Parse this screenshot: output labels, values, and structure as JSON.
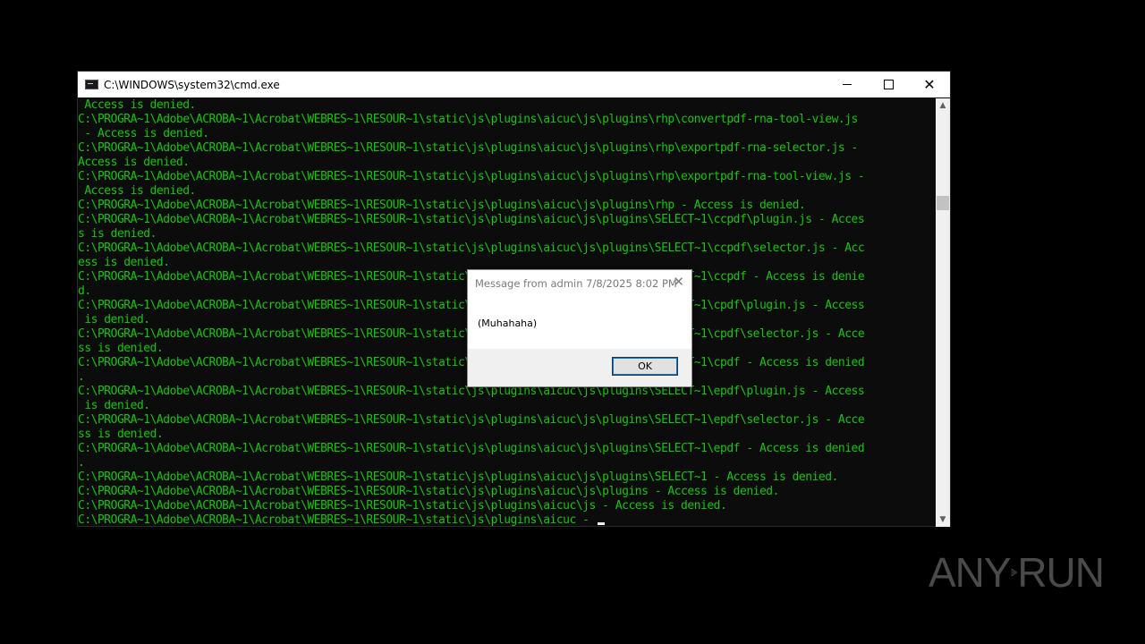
{
  "window": {
    "title": "C:\\WINDOWS\\system32\\cmd.exe",
    "controls": {
      "minimize": "minimize",
      "maximize": "maximize",
      "close": "✕"
    }
  },
  "console": {
    "lines": [
      " Access is denied.",
      "C:\\PROGRA~1\\Adobe\\ACROBA~1\\Acrobat\\WEBRES~1\\RESOUR~1\\static\\js\\plugins\\aicuc\\js\\plugins\\rhp\\convertpdf-rna-tool-view.js",
      " - Access is denied.",
      "C:\\PROGRA~1\\Adobe\\ACROBA~1\\Acrobat\\WEBRES~1\\RESOUR~1\\static\\js\\plugins\\aicuc\\js\\plugins\\rhp\\exportpdf-rna-selector.js -",
      "Access is denied.",
      "C:\\PROGRA~1\\Adobe\\ACROBA~1\\Acrobat\\WEBRES~1\\RESOUR~1\\static\\js\\plugins\\aicuc\\js\\plugins\\rhp\\exportpdf-rna-tool-view.js -",
      " Access is denied.",
      "C:\\PROGRA~1\\Adobe\\ACROBA~1\\Acrobat\\WEBRES~1\\RESOUR~1\\static\\js\\plugins\\aicuc\\js\\plugins\\rhp - Access is denied.",
      "C:\\PROGRA~1\\Adobe\\ACROBA~1\\Acrobat\\WEBRES~1\\RESOUR~1\\static\\js\\plugins\\aicuc\\js\\plugins\\SELECT~1\\ccpdf\\plugin.js - Acces",
      "s is denied.",
      "C:\\PROGRA~1\\Adobe\\ACROBA~1\\Acrobat\\WEBRES~1\\RESOUR~1\\static\\js\\plugins\\aicuc\\js\\plugins\\SELECT~1\\ccpdf\\selector.js - Acc",
      "ess is denied.",
      "C:\\PROGRA~1\\Adobe\\ACROBA~1\\Acrobat\\WEBRES~1\\RESOUR~1\\static\\js\\plugins\\aicuc\\js\\plugins\\SELECT~1\\ccpdf - Access is denie",
      "d.",
      "C:\\PROGRA~1\\Adobe\\ACROBA~1\\Acrobat\\WEBRES~1\\RESOUR~1\\static\\js\\plugins\\aicuc\\js\\plugins\\SELECT~1\\cpdf\\plugin.js - Access",
      " is denied.",
      "C:\\PROGRA~1\\Adobe\\ACROBA~1\\Acrobat\\WEBRES~1\\RESOUR~1\\static\\js\\plugins\\aicuc\\js\\plugins\\SELECT~1\\cpdf\\selector.js - Acce",
      "ss is denied.",
      "C:\\PROGRA~1\\Adobe\\ACROBA~1\\Acrobat\\WEBRES~1\\RESOUR~1\\static\\js\\plugins\\aicuc\\js\\plugins\\SELECT~1\\cpdf - Access is denied",
      ".",
      "C:\\PROGRA~1\\Adobe\\ACROBA~1\\Acrobat\\WEBRES~1\\RESOUR~1\\static\\js\\plugins\\aicuc\\js\\plugins\\SELECT~1\\epdf\\plugin.js - Access",
      " is denied.",
      "C:\\PROGRA~1\\Adobe\\ACROBA~1\\Acrobat\\WEBRES~1\\RESOUR~1\\static\\js\\plugins\\aicuc\\js\\plugins\\SELECT~1\\epdf\\selector.js - Acce",
      "ss is denied.",
      "C:\\PROGRA~1\\Adobe\\ACROBA~1\\Acrobat\\WEBRES~1\\RESOUR~1\\static\\js\\plugins\\aicuc\\js\\plugins\\SELECT~1\\epdf - Access is denied",
      ".",
      "C:\\PROGRA~1\\Adobe\\ACROBA~1\\Acrobat\\WEBRES~1\\RESOUR~1\\static\\js\\plugins\\aicuc\\js\\plugins\\SELECT~1 - Access is denied.",
      "C:\\PROGRA~1\\Adobe\\ACROBA~1\\Acrobat\\WEBRES~1\\RESOUR~1\\static\\js\\plugins\\aicuc\\js\\plugins - Access is denied.",
      "C:\\PROGRA~1\\Adobe\\ACROBA~1\\Acrobat\\WEBRES~1\\RESOUR~1\\static\\js\\plugins\\aicuc\\js - Access is denied.",
      "C:\\PROGRA~1\\Adobe\\ACROBA~1\\Acrobat\\WEBRES~1\\RESOUR~1\\static\\js\\plugins\\aicuc - "
    ],
    "text_color": "#16c60c",
    "background": "#0c0c0c"
  },
  "scrollbar": {
    "up_arrow": "▲",
    "down_arrow": "▼"
  },
  "message_box": {
    "title": "Message from admin 7/8/2025 8:02 PM",
    "close": "✕",
    "body": "(Muhahaha)",
    "ok_label": "OK"
  },
  "watermark": {
    "left_text": "ANY",
    "right_text": "RUN"
  }
}
